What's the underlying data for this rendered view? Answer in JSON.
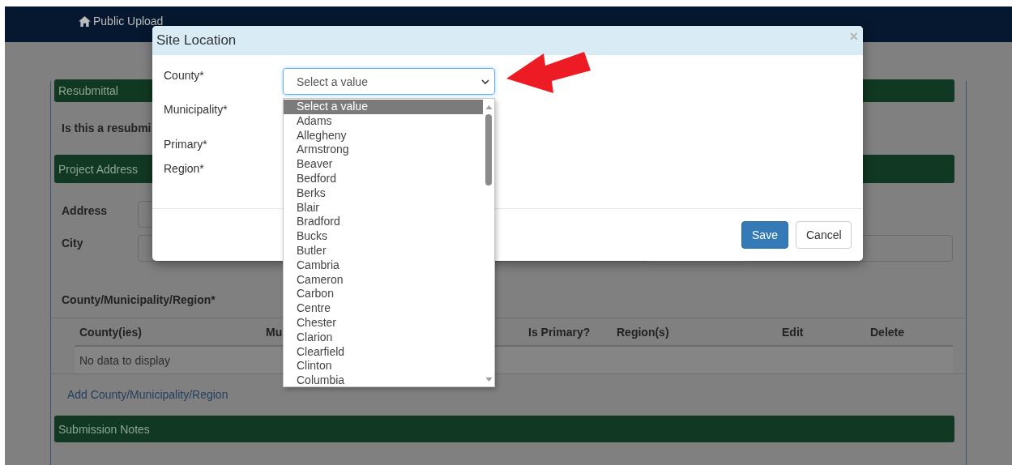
{
  "navbar": {
    "brand": "Public Upload"
  },
  "page": {
    "resubmittal_header": "Resubmittal",
    "resubmittal_question": "Is this a resubmi",
    "project_address_header": "Project Address",
    "address_label": "Address",
    "city_label": "City",
    "cmr_label": "County/Municipality/Region*",
    "table": {
      "columns": [
        "County(ies)",
        "Mu",
        "Is Primary?",
        "Region(s)",
        "Edit",
        "Delete"
      ],
      "empty_text": "No data to display"
    },
    "add_link": "Add County/Municipality/Region",
    "submission_notes_header": "Submission Notes"
  },
  "modal": {
    "title": "Site Location",
    "close": "×",
    "fields": [
      {
        "label": "County*"
      },
      {
        "label": "Municipality*"
      },
      {
        "label": "Primary*"
      },
      {
        "label": "Region*"
      }
    ],
    "county_select": {
      "value": "Select a value",
      "expanded": true,
      "options": [
        {
          "label": "Select a value",
          "selected": true
        },
        {
          "label": "Adams",
          "selected": false
        },
        {
          "label": "Allegheny",
          "selected": false
        },
        {
          "label": "Armstrong",
          "selected": false
        },
        {
          "label": "Beaver",
          "selected": false
        },
        {
          "label": "Bedford",
          "selected": false
        },
        {
          "label": "Berks",
          "selected": false
        },
        {
          "label": "Blair",
          "selected": false
        },
        {
          "label": "Bradford",
          "selected": false
        },
        {
          "label": "Bucks",
          "selected": false
        },
        {
          "label": "Butler",
          "selected": false
        },
        {
          "label": "Cambria",
          "selected": false
        },
        {
          "label": "Cameron",
          "selected": false
        },
        {
          "label": "Carbon",
          "selected": false
        },
        {
          "label": "Centre",
          "selected": false
        },
        {
          "label": "Chester",
          "selected": false
        },
        {
          "label": "Clarion",
          "selected": false
        },
        {
          "label": "Clearfield",
          "selected": false
        },
        {
          "label": "Clinton",
          "selected": false
        },
        {
          "label": "Columbia",
          "selected": false
        }
      ]
    },
    "buttons": [
      {
        "label": "Save",
        "kind": "primary"
      },
      {
        "label": "Cancel",
        "kind": "default"
      }
    ]
  }
}
